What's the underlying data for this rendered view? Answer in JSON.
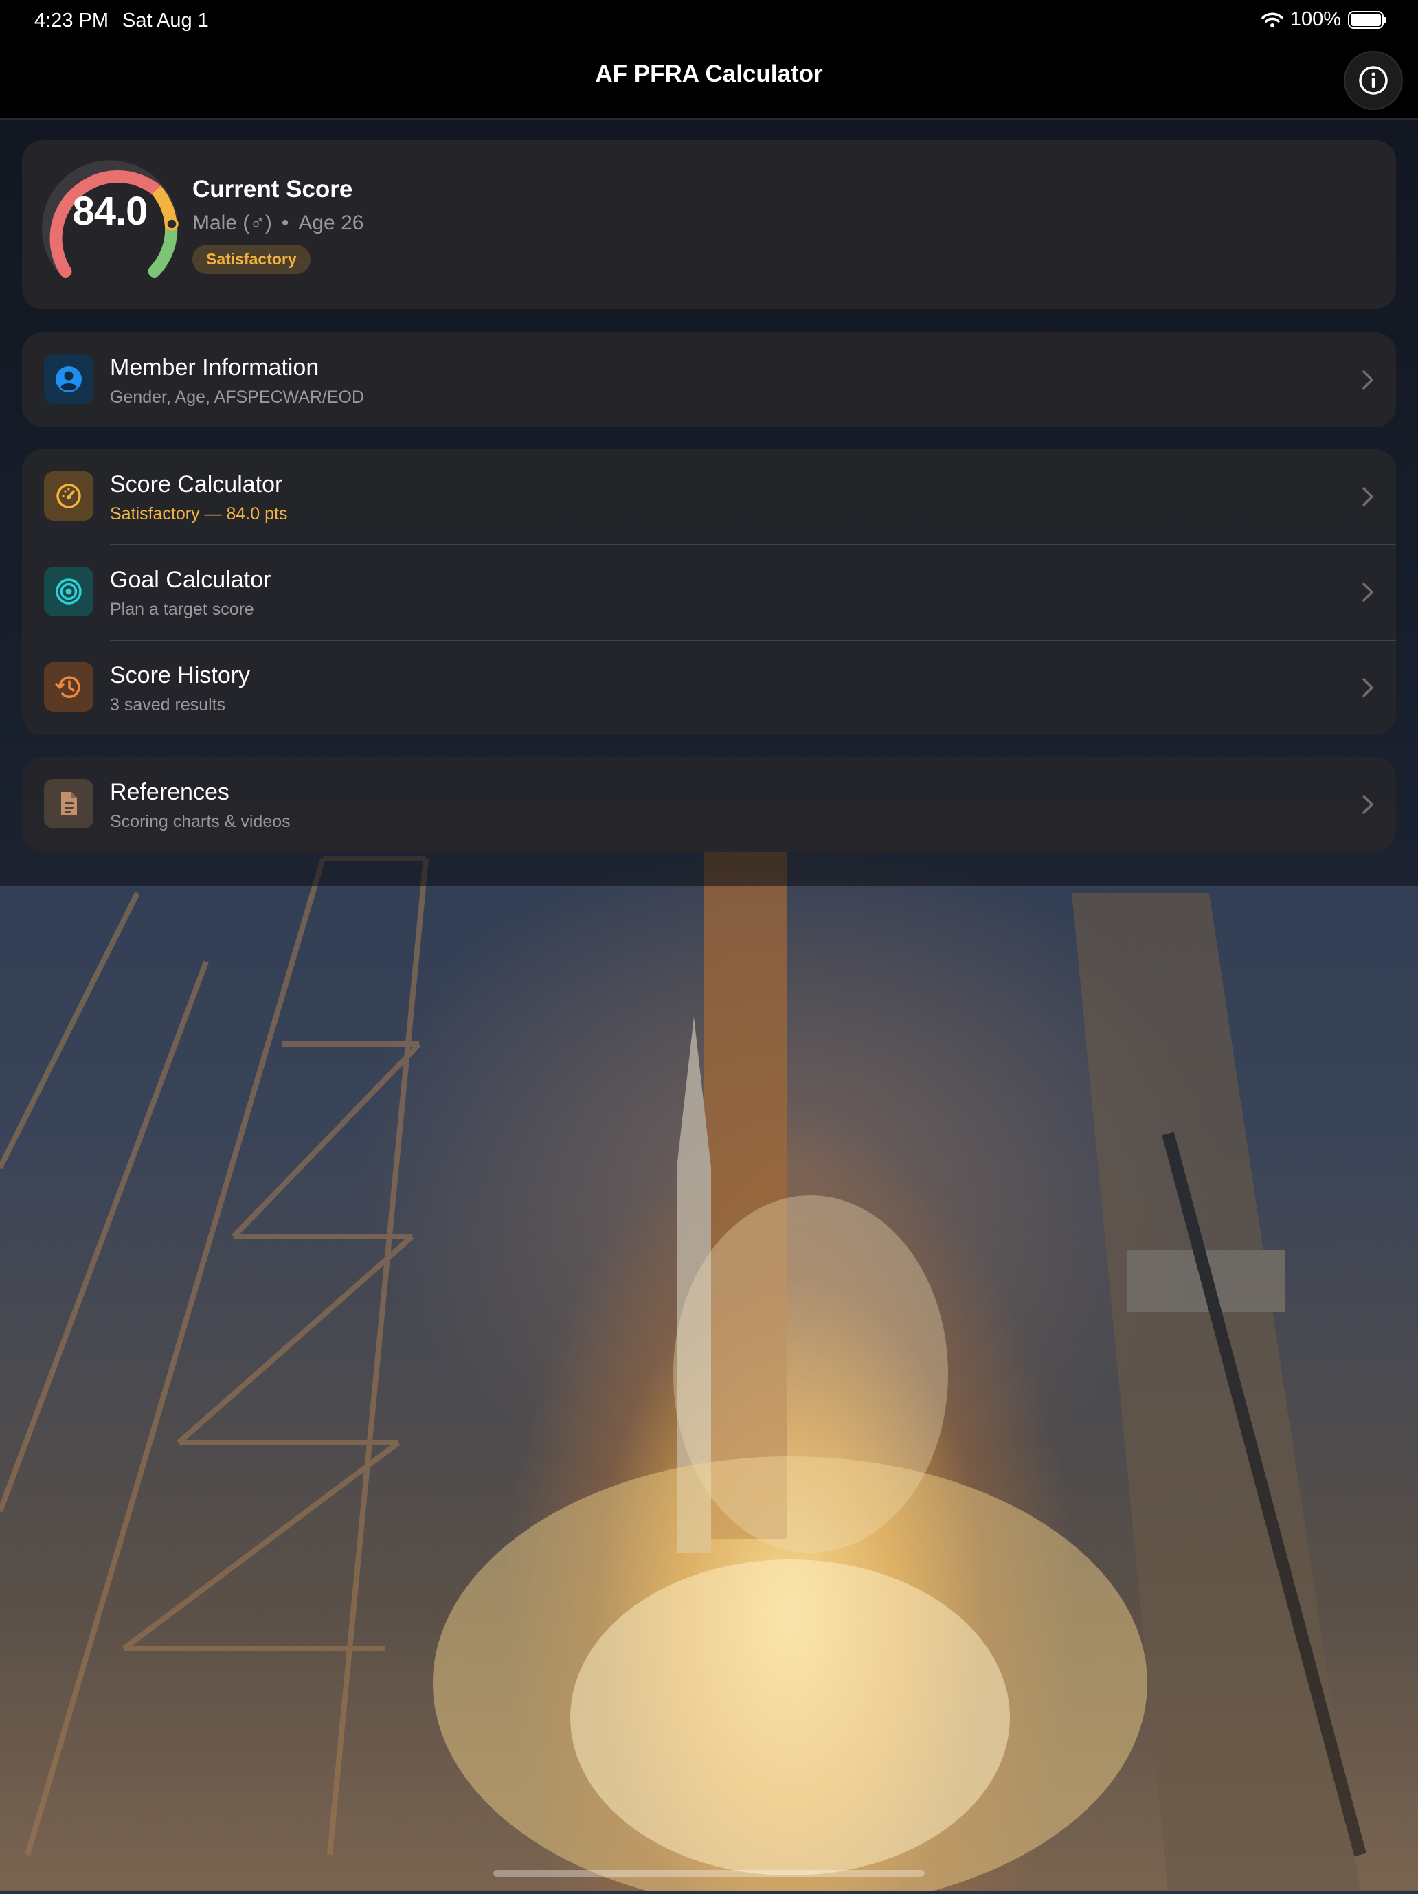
{
  "status_bar": {
    "time": "4:23 PM",
    "date": "Sat Aug 1",
    "battery": "100%"
  },
  "nav": {
    "title": "AF PFRA Calculator",
    "info_icon": "info-icon"
  },
  "score_card": {
    "score": "84.0",
    "score_fraction": 0.84,
    "title": "Current Score",
    "gender": "Male (♂)",
    "age": "Age 26",
    "separator": "•",
    "badge": "Satisfactory",
    "colors": {
      "low": "#e8716f",
      "mid": "#f4b23e",
      "high": "#7cc576"
    }
  },
  "member_info": {
    "title": "Member Information",
    "subtitle": "Gender, Age, AFSPECWAR/EOD",
    "icon": "person-icon"
  },
  "tools": [
    {
      "title": "Score Calculator",
      "subtitle": "Satisfactory — 84.0 pts",
      "icon": "speedometer-icon"
    },
    {
      "title": "Goal Calculator",
      "subtitle": "Plan a target score",
      "icon": "target-icon"
    },
    {
      "title": "Score History",
      "subtitle": "3 saved results",
      "icon": "history-icon"
    }
  ],
  "references": {
    "title": "References",
    "subtitle": "Scoring charts & videos",
    "icon": "document-icon"
  }
}
